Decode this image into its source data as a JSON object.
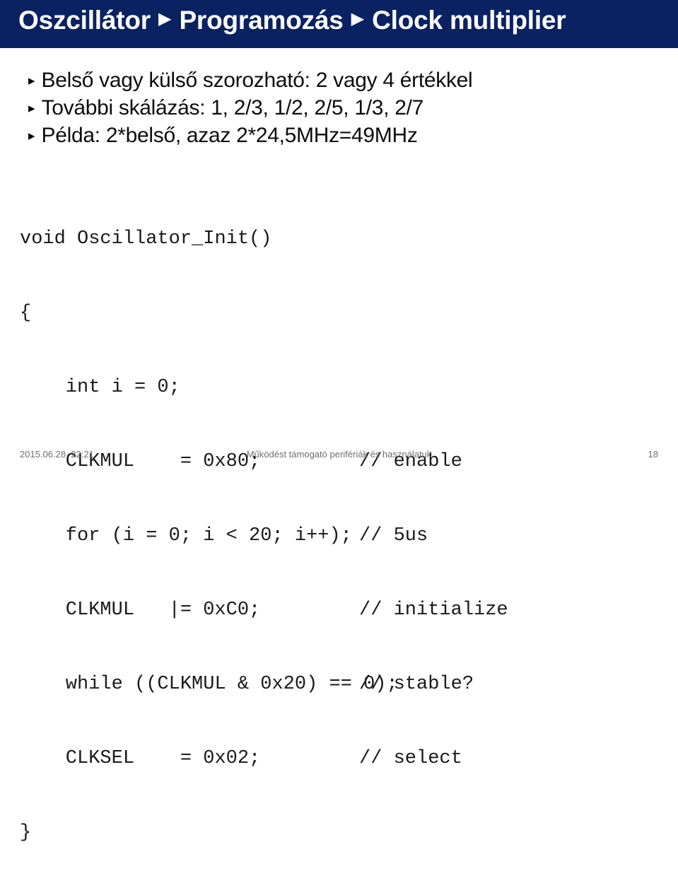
{
  "colors": {
    "header_band": "#0a2262",
    "header_text": "#ffffff",
    "body_background": "#ffffff",
    "body_text": "#0d0d0d",
    "code_text": "#1a1a1a",
    "footer_text": "#6f6f6f"
  },
  "header": {
    "breadcrumb": [
      {
        "label": "Oszcillátor"
      },
      {
        "label": "Programozás"
      },
      {
        "label": "Clock multiplier"
      }
    ],
    "separator": "▶"
  },
  "bullets": {
    "marker": "▸",
    "items": [
      {
        "text": "Belső vagy külső szorozható: 2 vagy 4 értékkel"
      },
      {
        "text": "További skálázás: 1, 2/3, 1/2, 2/5, 1/3, 2/7"
      },
      {
        "text": "Példa: 2*belső, azaz 2*24,5MHz=49MHz"
      }
    ]
  },
  "code": {
    "language": "c",
    "lines": [
      {
        "code": "void Oscillator_Init()",
        "comment": ""
      },
      {
        "code": "{",
        "comment": ""
      },
      {
        "code": "    int i = 0;",
        "comment": ""
      },
      {
        "code": "    CLKMUL    = 0x80;",
        "comment": "// enable"
      },
      {
        "code": "    for (i = 0; i < 20; i++);",
        "comment": "// 5us"
      },
      {
        "code": "    CLKMUL   |= 0xC0;",
        "comment": "// initialize"
      },
      {
        "code": "    while ((CLKMUL & 0x20) == 0);",
        "comment": "// stable?"
      },
      {
        "code": "    CLKSEL    = 0x02;",
        "comment": "// select"
      },
      {
        "code": "}",
        "comment": ""
      }
    ]
  },
  "footer": {
    "datetime": "2015.06.28. 22:21",
    "subject": "Működést támogató perifériák és használatuk",
    "page_number": "18"
  }
}
